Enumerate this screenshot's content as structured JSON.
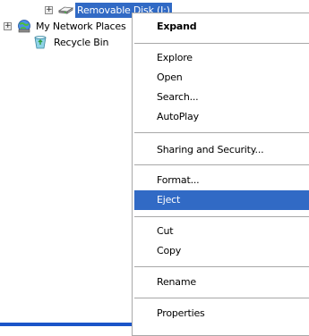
{
  "tree": {
    "items": [
      {
        "label": "Removable Disk (J:)",
        "icon": "removable-disk-icon",
        "expander": "+"
      },
      {
        "label": "My Network Places",
        "icon": "network-places-icon",
        "expander": "+"
      },
      {
        "label": "Recycle Bin",
        "icon": "recycle-bin-icon",
        "expander": ""
      }
    ],
    "selection_color": "#316ac5"
  },
  "context_menu": {
    "items": [
      {
        "label": "Expand",
        "default": true
      },
      {
        "label": "Explore"
      },
      {
        "label": "Open"
      },
      {
        "label": "Search..."
      },
      {
        "label": "AutoPlay"
      },
      {
        "label": "Sharing and Security..."
      },
      {
        "label": "Format..."
      },
      {
        "label": "Eject",
        "highlighted": true
      },
      {
        "label": "Cut"
      },
      {
        "label": "Copy"
      },
      {
        "label": "Rename"
      },
      {
        "label": "Properties"
      }
    ],
    "highlight_color": "#316ac5",
    "separator_color": "#a7a7a7"
  }
}
